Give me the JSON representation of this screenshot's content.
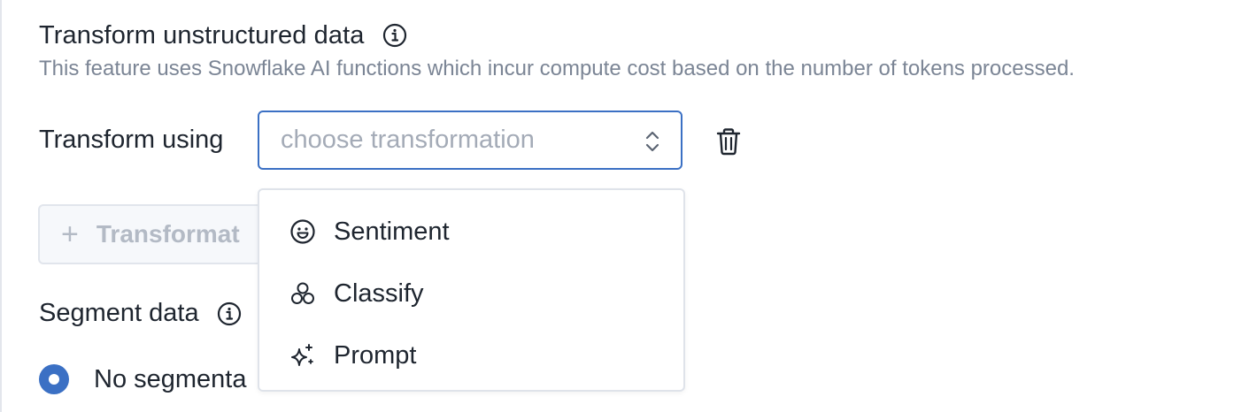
{
  "section": {
    "title": "Transform unstructured data",
    "description": "This feature uses Snowflake AI functions which incur compute cost based on the number of tokens processed."
  },
  "transform": {
    "label": "Transform using",
    "placeholder": "choose transformation",
    "delete_icon": "trash-icon",
    "add_button_label": "Transformat"
  },
  "dropdown": {
    "options": [
      {
        "label": "Sentiment",
        "icon": "smile-icon"
      },
      {
        "label": "Classify",
        "icon": "circles-icon"
      },
      {
        "label": "Prompt",
        "icon": "sparkle-icon"
      }
    ]
  },
  "segment": {
    "title": "Segment data",
    "radio_label": "No segmenta"
  },
  "colors": {
    "accent": "#3b70c4",
    "muted_text": "#7b8595",
    "border": "#dfe3ea"
  }
}
